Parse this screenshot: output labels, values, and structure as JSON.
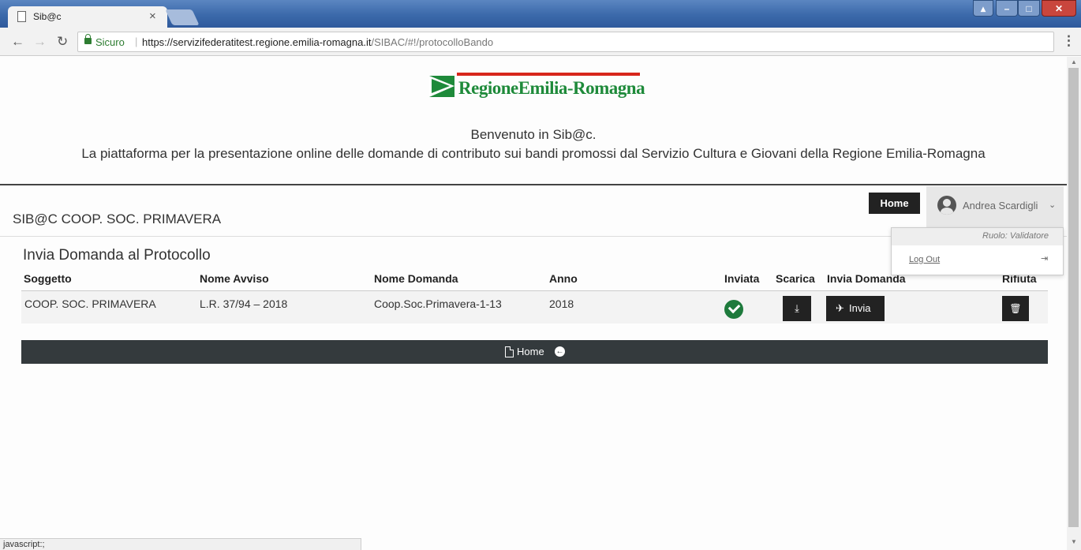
{
  "browser": {
    "tab_title": "Sib@c",
    "tab_close": "×",
    "secure_label": "Sicuro",
    "url_host": "https://servizifederatitest.regione.emilia-romagna.it",
    "url_path": "/SIBAC/#!/protocolloBando",
    "status_text": "javascript:;"
  },
  "header": {
    "logo_text": "RegioneEmilia-Romagna",
    "welcome": "Benvenuto in Sib@c.",
    "tagline": "La piattaforma per la presentazione online delle domande di contributo sui bandi promossi dal Servizio Cultura e Giovani della Regione Emilia-Romagna"
  },
  "navbar": {
    "coop_name": "SIB@C COOP. SOC. PRIMAVERA",
    "home_label": "Home",
    "user_name": "Andrea Scardigli",
    "dropdown": {
      "role": "Ruolo: Validatore",
      "logout": "Log Out"
    }
  },
  "main": {
    "title": "Invia Domanda al Protocollo",
    "columns": [
      "Soggetto",
      "Nome Avviso",
      "Nome Domanda",
      "Anno",
      "Inviata",
      "Scarica",
      "Invia Domanda",
      "Rifiuta"
    ],
    "rows": [
      {
        "soggetto": "COOP. SOC. PRIMAVERA",
        "nome_avviso": "L.R. 37/94 – 2018",
        "nome_domanda": "Coop.Soc.Primavera-1-13",
        "anno": "2018",
        "inviata": true,
        "invia_label": "Invia"
      }
    ]
  },
  "footer": {
    "home_label": "Home"
  },
  "colors": {
    "titlebar": "#3b69aa",
    "logo_green": "#1e8a3a",
    "logo_red": "#d7261b",
    "dark_button": "#222222",
    "footer_bar": "#343a3d",
    "check_green": "#1e7a3c"
  }
}
